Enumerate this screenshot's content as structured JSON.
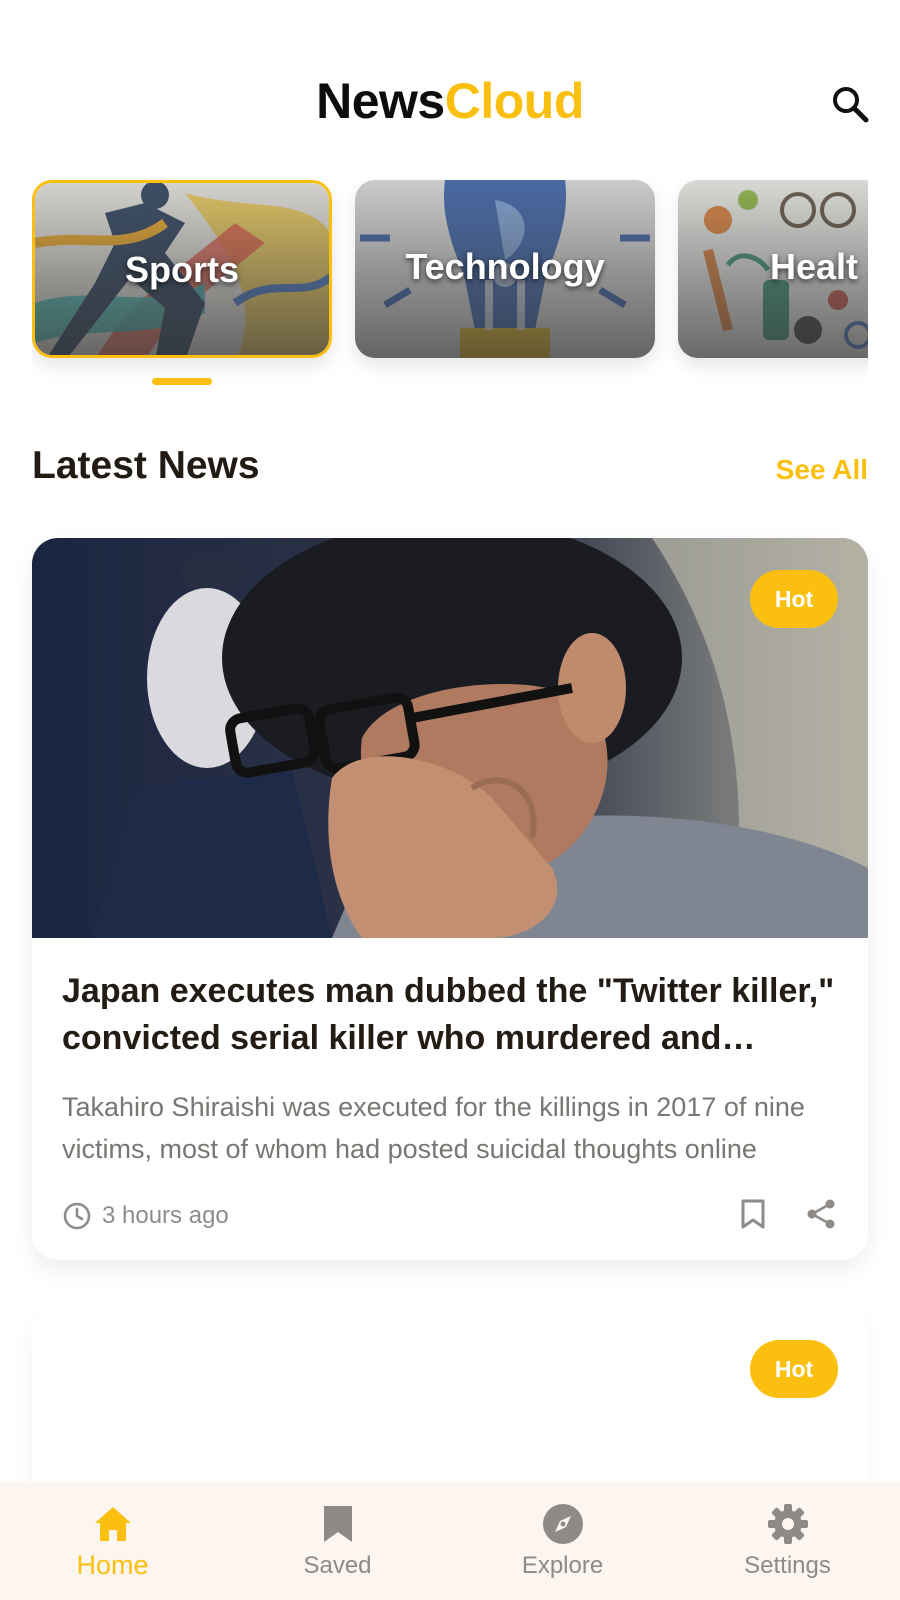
{
  "header": {
    "logo_part1": "News",
    "logo_part2": "Cloud",
    "search_icon": "search-icon"
  },
  "categories": [
    {
      "label": "Sports",
      "active": true
    },
    {
      "label": "Technology",
      "active": false
    },
    {
      "label": "Healt",
      "active": false
    }
  ],
  "latest": {
    "title": "Latest News",
    "see_all": "See All"
  },
  "articles": [
    {
      "badge": "Hot",
      "headline": "Japan executes man dubbed the \"Twitter killer,\" convicted serial killer who murdered and dismembered nine people",
      "summary": "Takahiro Shiraishi was executed for the killings in 2017 of nine victims, most of whom had posted suicidal thoughts online",
      "time": "3 hours ago",
      "icons": [
        "clock-icon",
        "bookmark-icon",
        "share-icon"
      ]
    },
    {
      "badge": "Hot"
    }
  ],
  "bottom_nav": [
    {
      "label": "Home",
      "icon": "home-icon",
      "active": true
    },
    {
      "label": "Saved",
      "icon": "bookmark-icon",
      "active": false
    },
    {
      "label": "Explore",
      "icon": "compass-icon",
      "active": false
    },
    {
      "label": "Settings",
      "icon": "gear-icon",
      "active": false
    }
  ],
  "colors": {
    "accent": "#fbbf0f",
    "text": "#211b14",
    "muted": "#7a7672",
    "nav_bg": "#fdf5ef"
  }
}
